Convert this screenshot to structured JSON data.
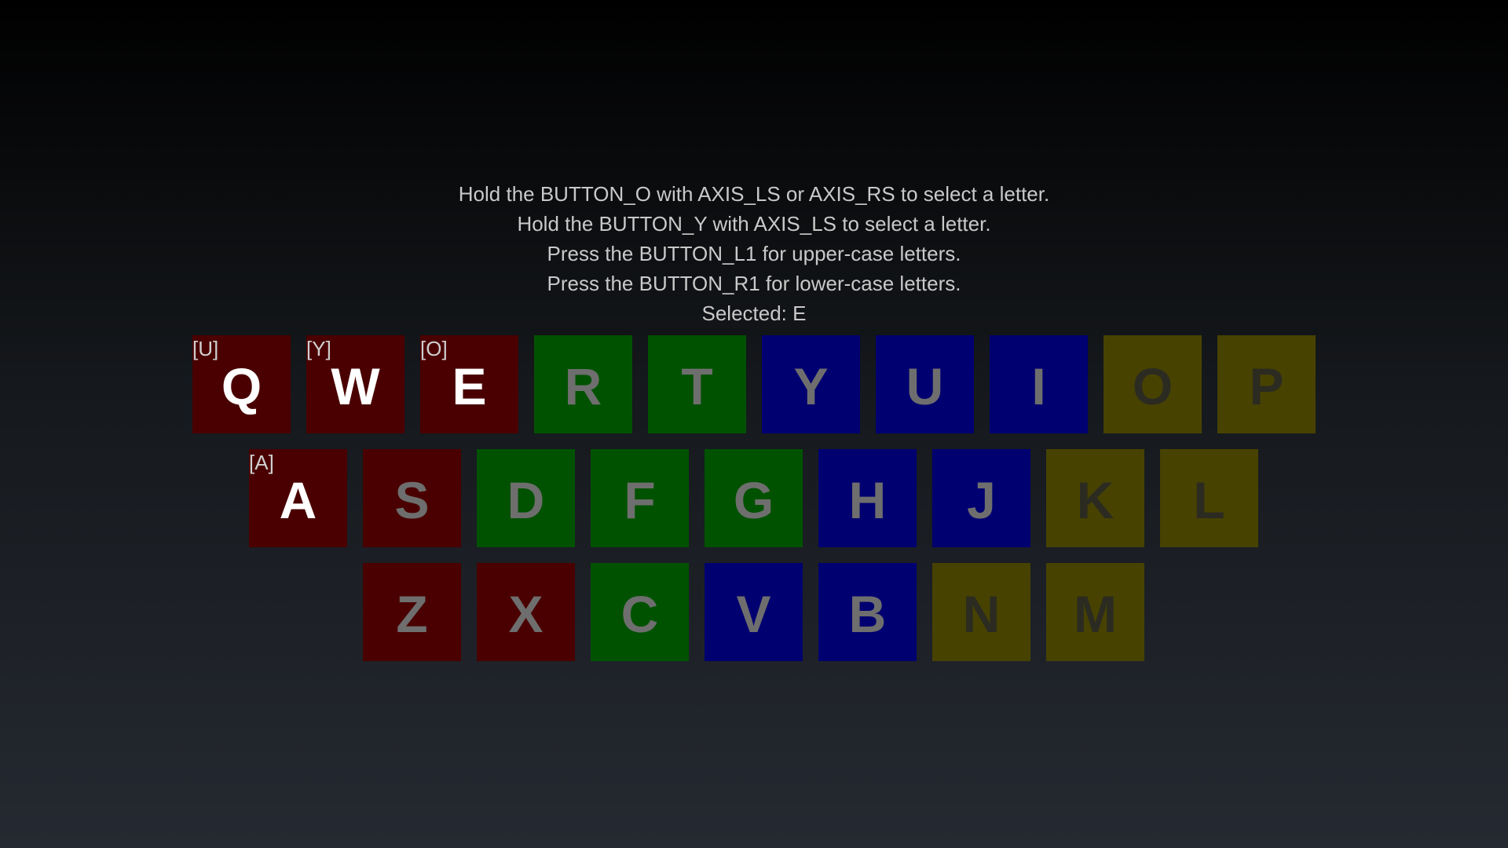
{
  "instructions": [
    "Hold the BUTTON_O with AXIS_LS or AXIS_RS to select a letter.",
    "Hold the BUTTON_Y with AXIS_LS to select a letter.",
    "Press the BUTTON_L1 for upper-case letters.",
    "Press the BUTTON_R1 for lower-case letters.",
    "Selected: E"
  ],
  "colors": {
    "red": "#4a0000",
    "green": "#005200",
    "blue": "#010070",
    "yellow": "#474200",
    "active_text": "#ffffff",
    "dim_text": "#6e6e6e",
    "yellow_text": "#2b2b22"
  },
  "keyboard": {
    "rows": [
      [
        {
          "letter": "Q",
          "group": "red",
          "active": true,
          "tag": "[U]"
        },
        {
          "letter": "W",
          "group": "red",
          "active": true,
          "tag": "[Y]"
        },
        {
          "letter": "E",
          "group": "red",
          "active": true,
          "tag": "[O]"
        },
        {
          "letter": "R",
          "group": "green",
          "active": false
        },
        {
          "letter": "T",
          "group": "green",
          "active": false
        },
        {
          "letter": "Y",
          "group": "blue",
          "active": false
        },
        {
          "letter": "U",
          "group": "blue",
          "active": false
        },
        {
          "letter": "I",
          "group": "blue",
          "active": false
        },
        {
          "letter": "O",
          "group": "yellow",
          "active": false
        },
        {
          "letter": "P",
          "group": "yellow",
          "active": false
        }
      ],
      [
        {
          "letter": "A",
          "group": "red",
          "active": true,
          "tag": "[A]"
        },
        {
          "letter": "S",
          "group": "red",
          "active": false
        },
        {
          "letter": "D",
          "group": "green",
          "active": false
        },
        {
          "letter": "F",
          "group": "green",
          "active": false
        },
        {
          "letter": "G",
          "group": "green",
          "active": false
        },
        {
          "letter": "H",
          "group": "blue",
          "active": false
        },
        {
          "letter": "J",
          "group": "blue",
          "active": false
        },
        {
          "letter": "K",
          "group": "yellow",
          "active": false
        },
        {
          "letter": "L",
          "group": "yellow",
          "active": false
        }
      ],
      [
        {
          "letter": "Z",
          "group": "red",
          "active": false
        },
        {
          "letter": "X",
          "group": "red",
          "active": false
        },
        {
          "letter": "C",
          "group": "green",
          "active": false
        },
        {
          "letter": "V",
          "group": "blue",
          "active": false
        },
        {
          "letter": "B",
          "group": "blue",
          "active": false
        },
        {
          "letter": "N",
          "group": "yellow",
          "active": false
        },
        {
          "letter": "M",
          "group": "yellow",
          "active": false
        }
      ]
    ]
  }
}
